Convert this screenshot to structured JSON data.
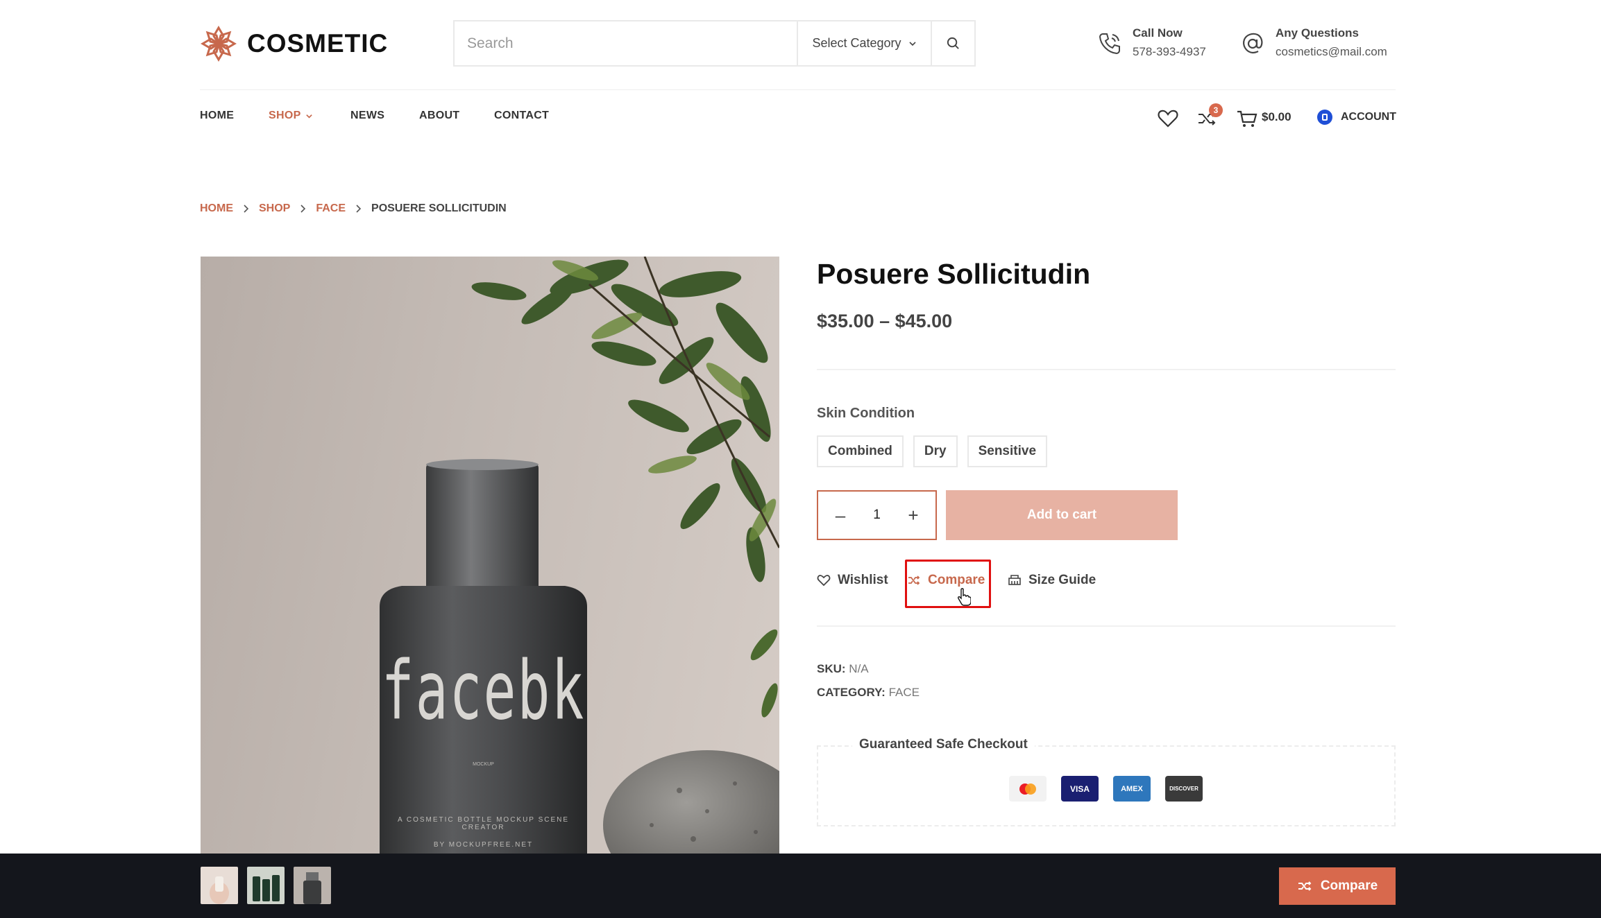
{
  "brand": {
    "name": "COSMETIC",
    "accent": "#c7684c"
  },
  "search": {
    "placeholder": "Search",
    "category": "Select Category"
  },
  "contact": {
    "phone": {
      "title": "Call Now",
      "value": "578-393-4937"
    },
    "email": {
      "title": "Any Questions",
      "value": "cosmetics@mail.com"
    }
  },
  "nav": {
    "items": [
      {
        "label": "HOME"
      },
      {
        "label": "SHOP"
      },
      {
        "label": "NEWS"
      },
      {
        "label": "ABOUT"
      },
      {
        "label": "CONTACT"
      }
    ],
    "compare_count": "3",
    "cart_total": "$0.00",
    "account_label": "ACCOUNT"
  },
  "breadcrumb": {
    "items": [
      "HOME",
      "SHOP",
      "FACE"
    ],
    "current": "POSUERE SOLLICITUDIN"
  },
  "product": {
    "title": "Posuere Sollicitudin",
    "price": "$35.00 – $45.00",
    "skin_condition_label": "Skin Condition",
    "variants": [
      "Combined",
      "Dry",
      "Sensitive"
    ],
    "quantity": "1",
    "add_to_cart": "Add to cart",
    "actions": {
      "wishlist": "Wishlist",
      "compare": "Compare",
      "size_guide": "Size Guide"
    },
    "sku_label": "SKU:",
    "sku_value": "N/A",
    "category_label": "CATEGORY:",
    "category_value": "FACE",
    "safe_checkout": "Guaranteed Safe Checkout",
    "payment_cards": [
      "mastercard-icon",
      "VISA",
      "AMEX",
      "DISCOVER"
    ],
    "bottle_text": "facebk",
    "bottle_small_1": "A COSMETIC BOTTLE MOCKUP SCENE CREATOR",
    "bottle_small_2": "BY MOCKUPFREE.NET",
    "bottle_small_3": "MOCKUP"
  },
  "bottom_bar": {
    "compare_label": "Compare",
    "thumbnail_count": 3
  }
}
